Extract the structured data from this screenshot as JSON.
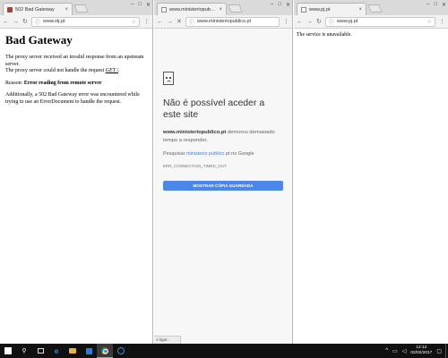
{
  "window1": {
    "tab_title": "502 Bad Gateway",
    "url": "www.stj.pt",
    "heading": "Bad Gateway",
    "para1": "The proxy server received an invalid response from an upstream server.",
    "para2_text": "The proxy server could not handle the request ",
    "para2_link": "GET /",
    "para2_end": ".",
    "reason_label": "Reason: ",
    "reason_value": "Error reading from remote server",
    "para3": "Additionally, a 502 Bad Gateway error was encountered while trying to use an ErrorDocument to handle the request."
  },
  "window2": {
    "tab_title": "www.ministeriopublico.p",
    "url": "www.ministeriopublico.pt",
    "heading": "Não é possível aceder a este site",
    "desc_bold": "www.ministeriopublico.pt",
    "desc_rest": " demorou demasiado tempo a responder.",
    "sugg_prefix": "Pesquisar ",
    "sugg_link": "ministerio publico",
    "sugg_suffix": " pt no Google",
    "error_code": "ERR_CONNECTION_TIMED_OUT",
    "button_label": "MOSTRAR CÓPIA GUARDADA",
    "status": "A ligar..."
  },
  "window3": {
    "tab_title": "www.pj.pt",
    "url": "www.pj.pt",
    "body": "The service is unavailable."
  },
  "taskbar": {
    "time": "12:12",
    "date": "02/02/2017"
  }
}
